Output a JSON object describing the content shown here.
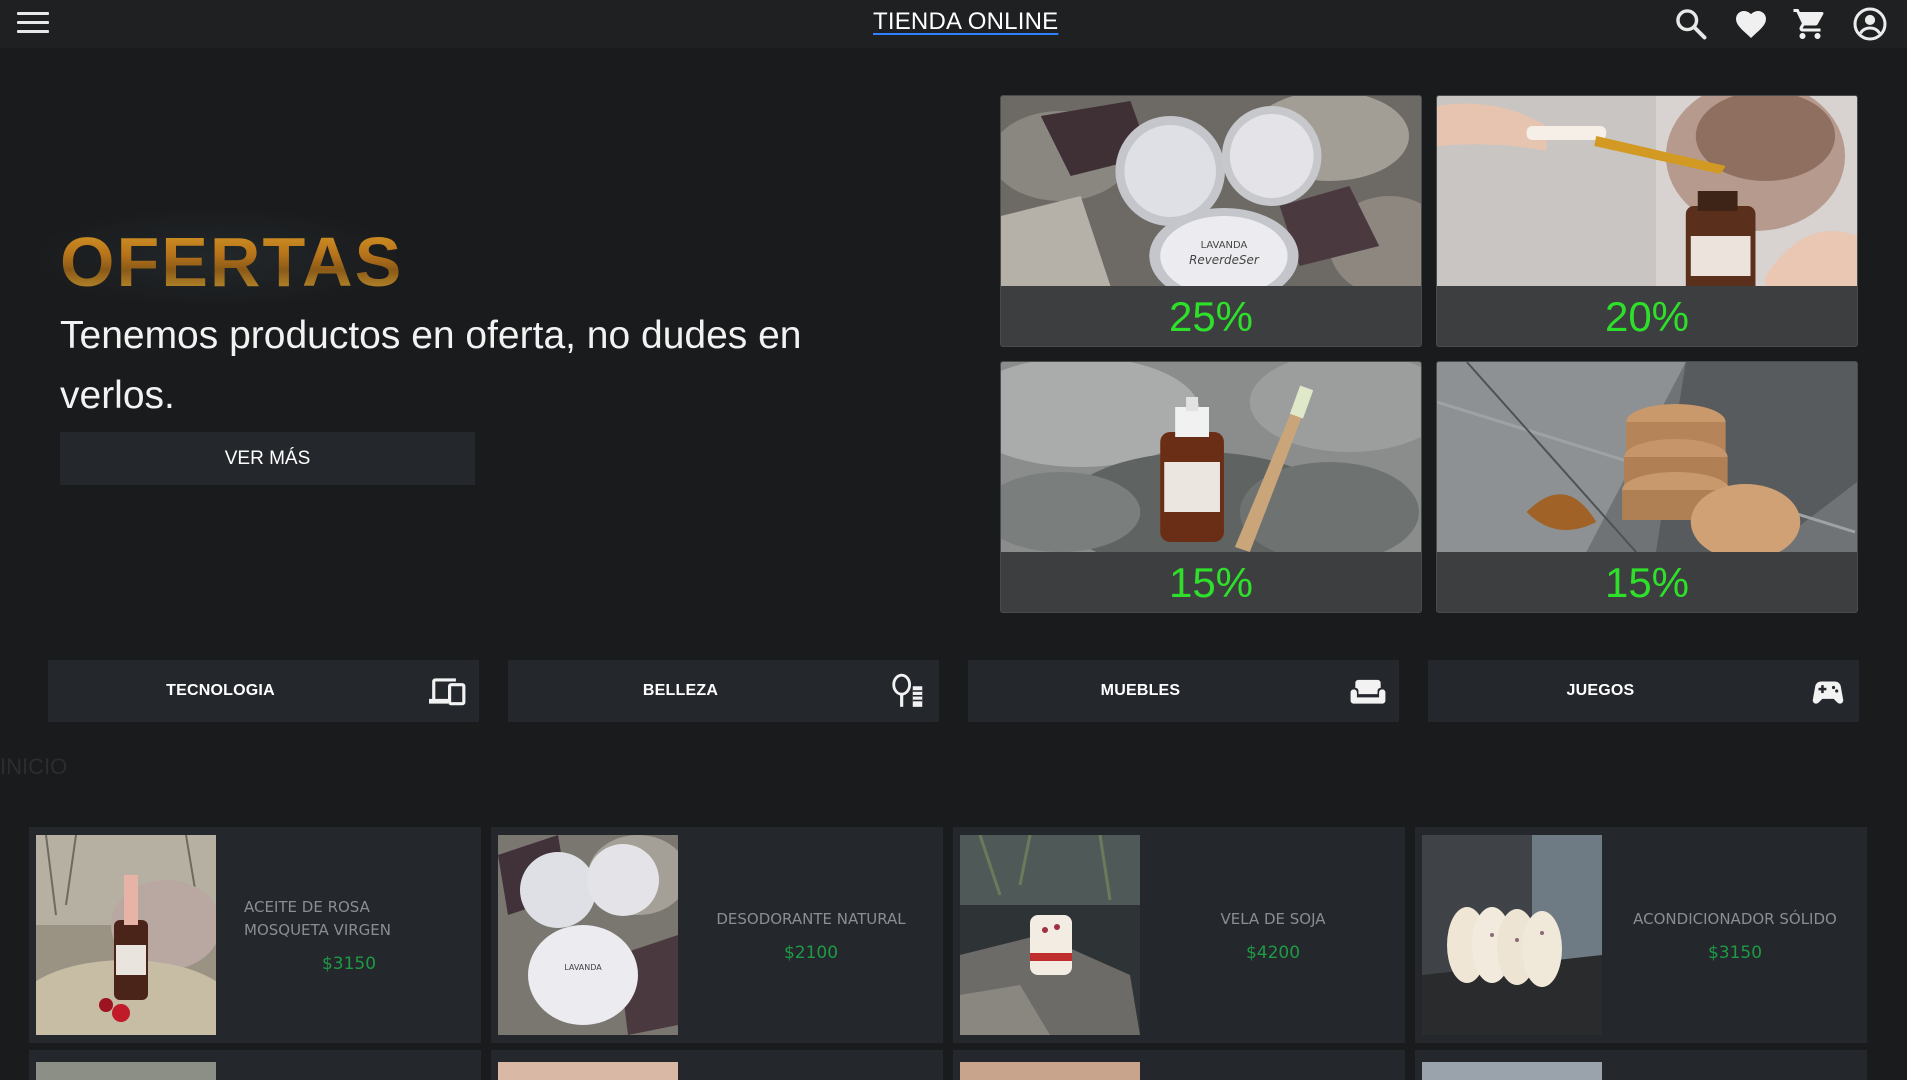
{
  "header": {
    "brand": "TIENDA ONLINE",
    "icons": [
      "menu-icon",
      "search-icon",
      "heart-icon",
      "cart-icon",
      "account-icon"
    ]
  },
  "hero": {
    "title": "OFERTAS",
    "text": "Tenemos productos en oferta, no dudes en verlos.",
    "button": "VER MÁS"
  },
  "offers": [
    {
      "discount": "25%"
    },
    {
      "discount": "20%"
    },
    {
      "discount": "15%"
    },
    {
      "discount": "15%"
    }
  ],
  "categories": [
    {
      "label": "TECNOLOGIA",
      "icon": "devices-icon"
    },
    {
      "label": "BELLEZA",
      "icon": "mirror-icon"
    },
    {
      "label": "MUEBLES",
      "icon": "sofa-icon"
    },
    {
      "label": "JUEGOS",
      "icon": "gamepad-icon"
    }
  ],
  "section": {
    "label": "INICIO"
  },
  "products": [
    {
      "name": "ACEITE DE ROSA MOSQUETA VIRGEN",
      "price": "$3150"
    },
    {
      "name": "DESODORANTE NATURAL",
      "price": "$2100"
    },
    {
      "name": "VELA DE SOJA",
      "price": "$4200"
    },
    {
      "name": "ACONDICIONADOR SÓLIDO",
      "price": "$3150"
    }
  ],
  "colors": {
    "background": "#1a1b1d",
    "panel": "#24272c",
    "discount": "#2ee02a",
    "price": "#1f9a44",
    "brand_underline": "#2f80ff"
  }
}
